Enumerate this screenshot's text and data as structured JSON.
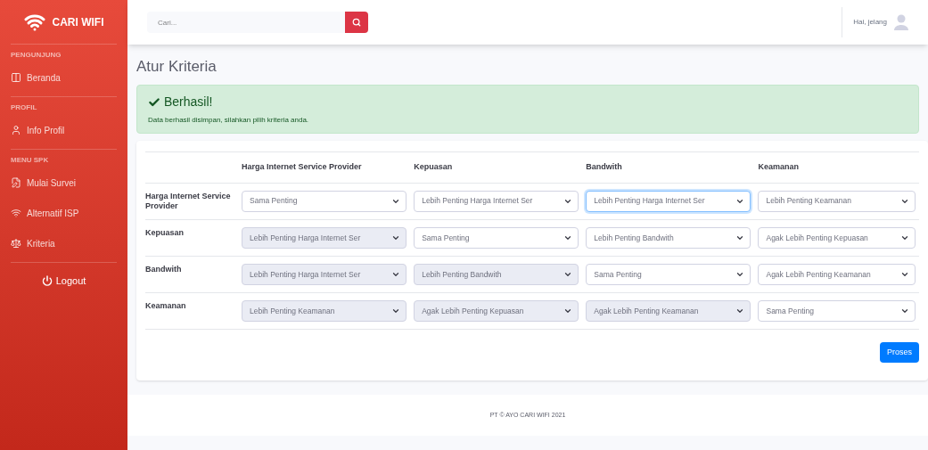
{
  "sidebar": {
    "brand": "CARI WIFI",
    "sections": [
      {
        "heading": "PENGUNJUNG",
        "items": [
          {
            "label": "Beranda"
          }
        ]
      },
      {
        "heading": "PROFIL",
        "items": [
          {
            "label": "Info Profil"
          }
        ]
      },
      {
        "heading": "MENU SPK",
        "items": [
          {
            "label": "Mulai Survei"
          },
          {
            "label": "Alternatif ISP"
          },
          {
            "label": "Kriteria"
          }
        ]
      }
    ],
    "logout": "Logout"
  },
  "topbar": {
    "search_placeholder": "Cari...",
    "greeting": "Hai, jelang"
  },
  "page_title": "Atur Kriteria",
  "alert": {
    "title": "Berhasil!",
    "message": "Data berhasil disimpan, silahkan pilih kriteria anda."
  },
  "table": {
    "columns": [
      "Harga Internet Service Provider",
      "Kepuasan",
      "Bandwith",
      "Keamanan"
    ],
    "rows": [
      {
        "label": "Harga Internet Service Provider",
        "cells": [
          {
            "value": "Sama Penting",
            "disabled": false,
            "focused": false
          },
          {
            "value": "Lebih Penting Harga Internet Ser",
            "disabled": false,
            "focused": false
          },
          {
            "value": "Lebih Penting Harga Internet Ser",
            "disabled": false,
            "focused": true
          },
          {
            "value": "Lebih Penting Keamanan",
            "disabled": false,
            "focused": false
          }
        ]
      },
      {
        "label": "Kepuasan",
        "cells": [
          {
            "value": "Lebih Penting Harga Internet Ser",
            "disabled": true,
            "focused": false
          },
          {
            "value": "Sama Penting",
            "disabled": false,
            "focused": false
          },
          {
            "value": "Lebih Penting Bandwith",
            "disabled": false,
            "focused": false
          },
          {
            "value": "Agak Lebih Penting Kepuasan",
            "disabled": false,
            "focused": false
          }
        ]
      },
      {
        "label": "Bandwith",
        "cells": [
          {
            "value": "Lebih Penting Harga Internet Ser",
            "disabled": true,
            "focused": false
          },
          {
            "value": "Lebih Penting Bandwith",
            "disabled": true,
            "focused": false
          },
          {
            "value": "Sama Penting",
            "disabled": false,
            "focused": false
          },
          {
            "value": "Agak Lebih Penting Keamanan",
            "disabled": false,
            "focused": false
          }
        ]
      },
      {
        "label": "Keamanan",
        "cells": [
          {
            "value": "Lebih Penting Keamanan",
            "disabled": true,
            "focused": false
          },
          {
            "value": "Agak Lebih Penting Kepuasan",
            "disabled": true,
            "focused": false
          },
          {
            "value": "Agak Lebih Penting Keamanan",
            "disabled": true,
            "focused": false
          },
          {
            "value": "Sama Penting",
            "disabled": false,
            "focused": false
          }
        ]
      }
    ]
  },
  "submit": "Proses",
  "footer": "PT © AYO CARI WIFI 2021"
}
